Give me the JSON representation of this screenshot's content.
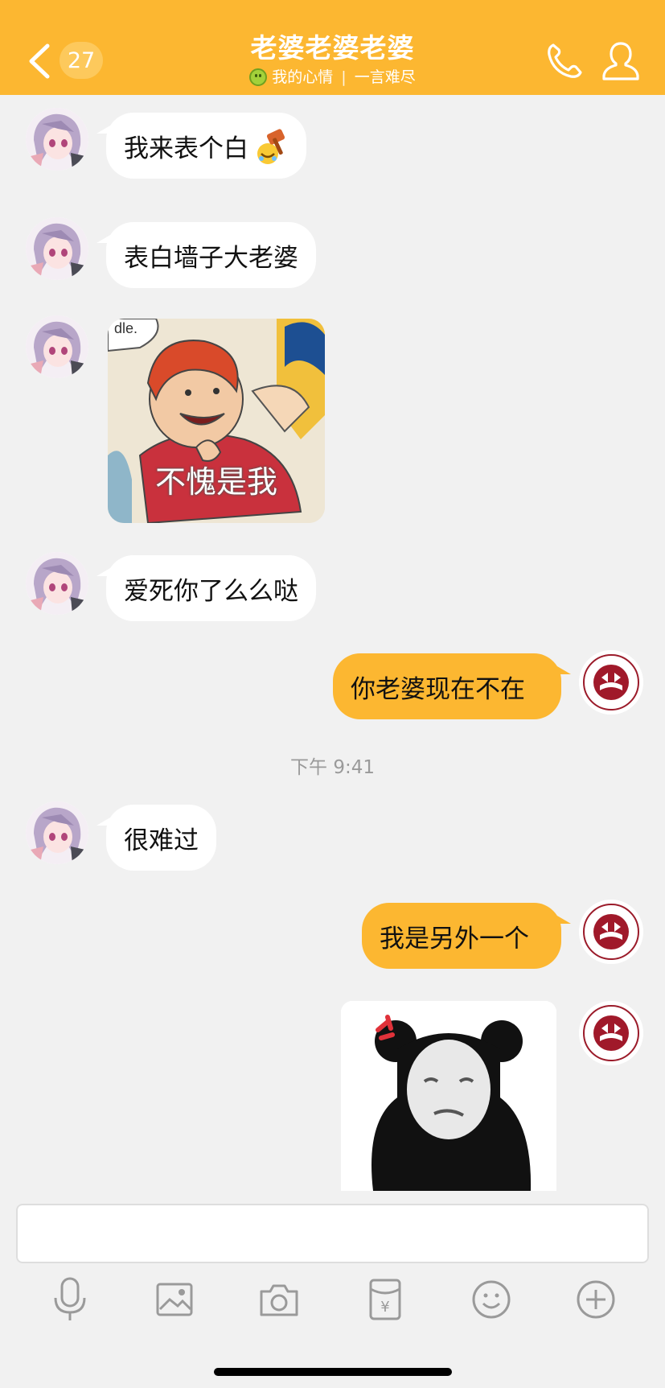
{
  "header": {
    "unread_count": "27",
    "title": "老婆老婆老婆",
    "status_label": "我的心情",
    "status_text": "一言难尽",
    "status_separator": "|"
  },
  "messages": [
    {
      "direction": "in",
      "type": "text",
      "text": "我来表个白",
      "has_emoji": "hammer-emoji"
    },
    {
      "direction": "in",
      "type": "text",
      "text": "表白墙子大老婆"
    },
    {
      "direction": "in",
      "type": "sticker",
      "caption": "不愧是我",
      "sticker_corner_text": "dle."
    },
    {
      "direction": "in",
      "type": "text",
      "text": "爱死你了么么哒"
    },
    {
      "direction": "out",
      "type": "text",
      "text": "你老婆现在不在"
    },
    {
      "type": "timestamp",
      "text": "下午 9:41"
    },
    {
      "direction": "in",
      "type": "text",
      "text": "很难过"
    },
    {
      "direction": "out",
      "type": "text",
      "text": "我是另外一个"
    },
    {
      "direction": "out",
      "type": "sticker",
      "caption": ""
    }
  ],
  "input": {
    "placeholder": ""
  },
  "toolbar": {
    "icons": [
      "microphone-icon",
      "image-icon",
      "camera-icon",
      "red-packet-icon",
      "emoji-icon",
      "plus-icon"
    ]
  },
  "colors": {
    "header_bg": "#fcb731",
    "outgoing_bubble": "#fcb731",
    "incoming_bubble": "#ffffff",
    "chat_bg": "#f1f1f1"
  }
}
